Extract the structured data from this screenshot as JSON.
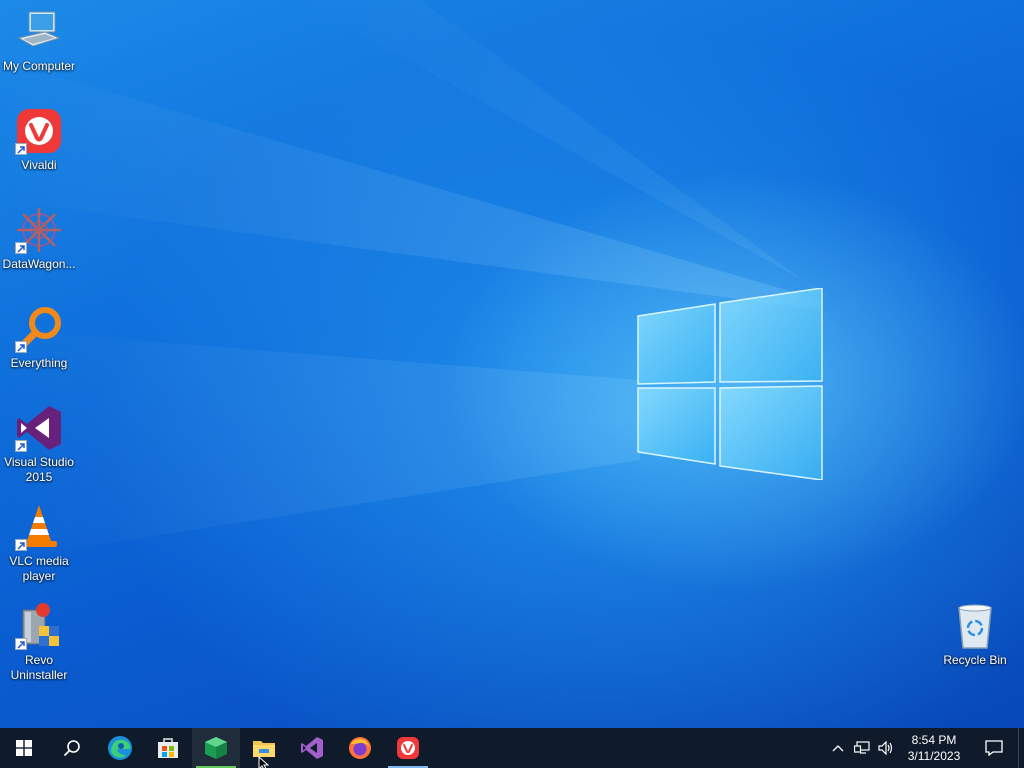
{
  "desktop": {
    "icons": [
      {
        "label": "My Computer",
        "icon": "computer-icon"
      },
      {
        "label": "Vivaldi",
        "icon": "vivaldi-icon"
      },
      {
        "label": "DataWagon...",
        "icon": "datawagon-icon"
      },
      {
        "label": "Everything",
        "icon": "everything-icon"
      },
      {
        "label": "Visual Studio\n2015",
        "icon": "visual-studio-icon"
      },
      {
        "label": "VLC media\nplayer",
        "icon": "vlc-icon"
      },
      {
        "label": "Revo\nUninstaller",
        "icon": "revo-uninstaller-icon"
      }
    ],
    "recycle_bin": {
      "label": "Recycle Bin",
      "icon": "recycle-bin-icon"
    }
  },
  "taskbar": {
    "buttons": [
      "start-icon",
      "search-icon",
      "edge-icon",
      "store-icon",
      "app-cube-icon",
      "file-explorer-icon",
      "visual-studio-icon",
      "firefox-icon",
      "vivaldi-icon"
    ],
    "clock": {
      "time": "8:54 PM",
      "date": "3/11/2023"
    },
    "tray": [
      "chevron-up-icon",
      "network-icon",
      "volume-icon",
      "notification-icon"
    ]
  },
  "colors": {
    "taskbar": "#0f1b2b",
    "wallpaper": "#0a5cd0",
    "accent": "#7fb6ef"
  }
}
